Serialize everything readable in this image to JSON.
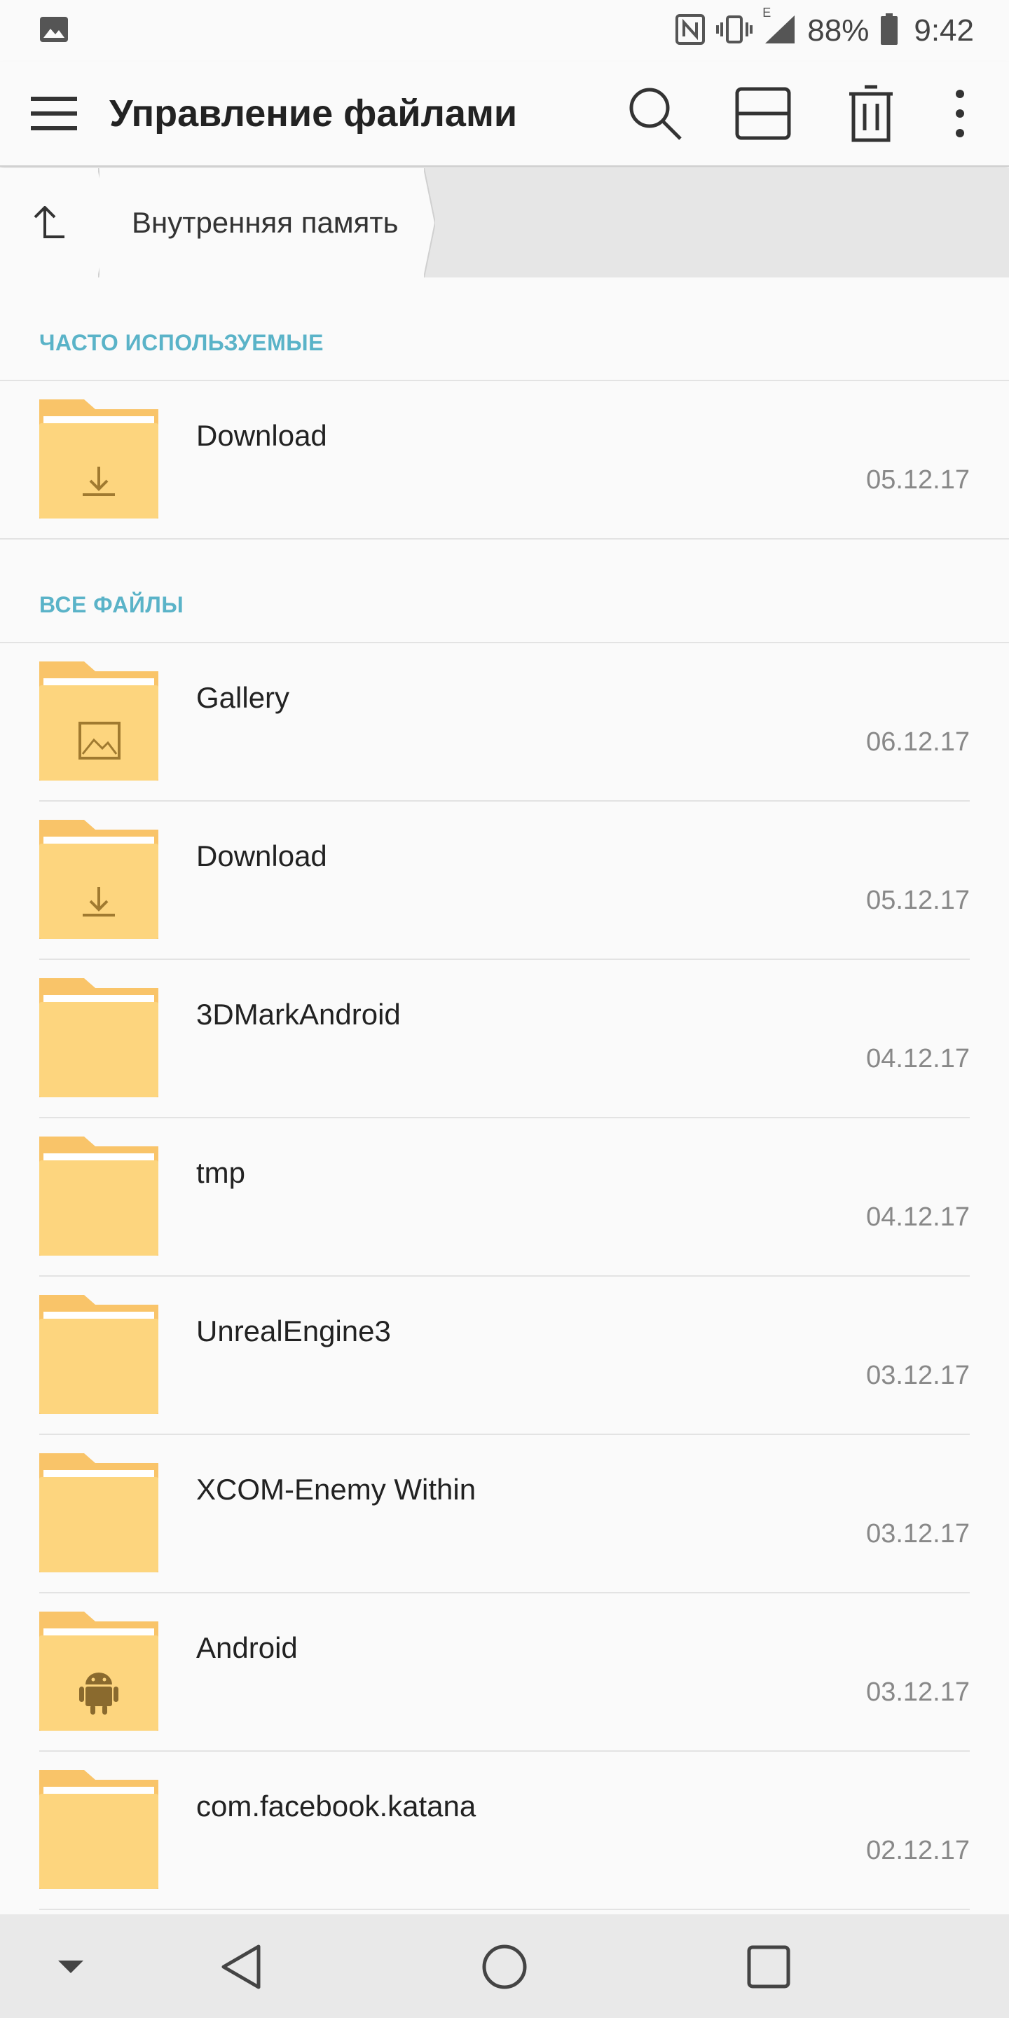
{
  "status_bar": {
    "battery_percent": "88%",
    "time": "9:42",
    "network_label": "E",
    "icons": [
      "gallery-notification-icon",
      "nfc-icon",
      "vibrate-icon",
      "signal-icon",
      "battery-icon"
    ]
  },
  "app_bar": {
    "title": "Управление файлами",
    "actions": [
      "search-icon",
      "view-toggle-icon",
      "delete-icon",
      "more-icon"
    ]
  },
  "breadcrumb": {
    "items": [
      "Внутренняя память"
    ]
  },
  "sections": {
    "frequent": {
      "header": "ЧАСТО ИСПОЛЬЗУЕМЫЕ",
      "items": [
        {
          "name": "Download",
          "date": "05.12.17",
          "badge": "download"
        }
      ]
    },
    "all": {
      "header": "ВСЕ ФАЙЛЫ",
      "items": [
        {
          "name": "Gallery",
          "date": "06.12.17",
          "badge": "image"
        },
        {
          "name": "Download",
          "date": "05.12.17",
          "badge": "download"
        },
        {
          "name": "3DMarkAndroid",
          "date": "04.12.17",
          "badge": "none"
        },
        {
          "name": "tmp",
          "date": "04.12.17",
          "badge": "none"
        },
        {
          "name": "UnrealEngine3",
          "date": "03.12.17",
          "badge": "none"
        },
        {
          "name": "XCOM-Enemy Within",
          "date": "03.12.17",
          "badge": "none"
        },
        {
          "name": "Android",
          "date": "03.12.17",
          "badge": "android"
        },
        {
          "name": "com.facebook.katana",
          "date": "02.12.17",
          "badge": "none"
        }
      ]
    }
  },
  "colors": {
    "accent": "#5ab3c8",
    "folder_body": "#fdd57e",
    "folder_tab": "#f9c469",
    "date_text": "#888888"
  },
  "nav_bar": {
    "buttons": [
      "hide-nav-icon",
      "back-icon",
      "home-icon",
      "recents-icon"
    ]
  }
}
